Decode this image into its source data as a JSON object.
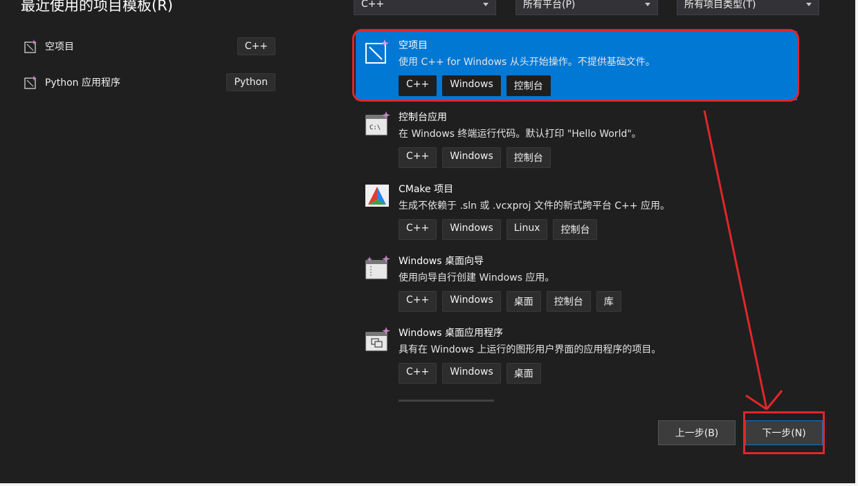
{
  "recent": {
    "title": "最近使用的项目模板(R)",
    "items": [
      {
        "label": "空项目",
        "tag": "C++"
      },
      {
        "label": "Python 应用程序",
        "tag": "Python"
      }
    ]
  },
  "filters": {
    "language": "C++",
    "platform": "所有平台(P)",
    "project_type": "所有项目类型(T)"
  },
  "templates": [
    {
      "name": "空项目",
      "description": "使用 C++ for Windows 从头开始操作。不提供基础文件。",
      "tags": [
        "C++",
        "Windows",
        "控制台"
      ],
      "selected": true
    },
    {
      "name": "控制台应用",
      "description": "在 Windows 终端运行代码。默认打印 \"Hello World\"。",
      "tags": [
        "C++",
        "Windows",
        "控制台"
      ],
      "selected": false
    },
    {
      "name": "CMake 项目",
      "description": "生成不依赖于 .sln 或 .vcxproj 文件的新式跨平台 C++ 应用。",
      "tags": [
        "C++",
        "Windows",
        "Linux",
        "控制台"
      ],
      "selected": false
    },
    {
      "name": "Windows 桌面向导",
      "description": "使用向导自行创建 Windows 应用。",
      "tags": [
        "C++",
        "Windows",
        "桌面",
        "控制台",
        "库"
      ],
      "selected": false
    },
    {
      "name": "Windows 桌面应用程序",
      "description": "具有在 Windows 上运行的图形用户界面的应用程序的项目。",
      "tags": [
        "C++",
        "Windows",
        "桌面"
      ],
      "selected": false
    }
  ],
  "buttons": {
    "back": "上一步(B)",
    "next": "下一步(N)"
  },
  "colors": {
    "accent": "#0078d4",
    "annotation": "#e3262a",
    "background": "#1f1f1f"
  }
}
